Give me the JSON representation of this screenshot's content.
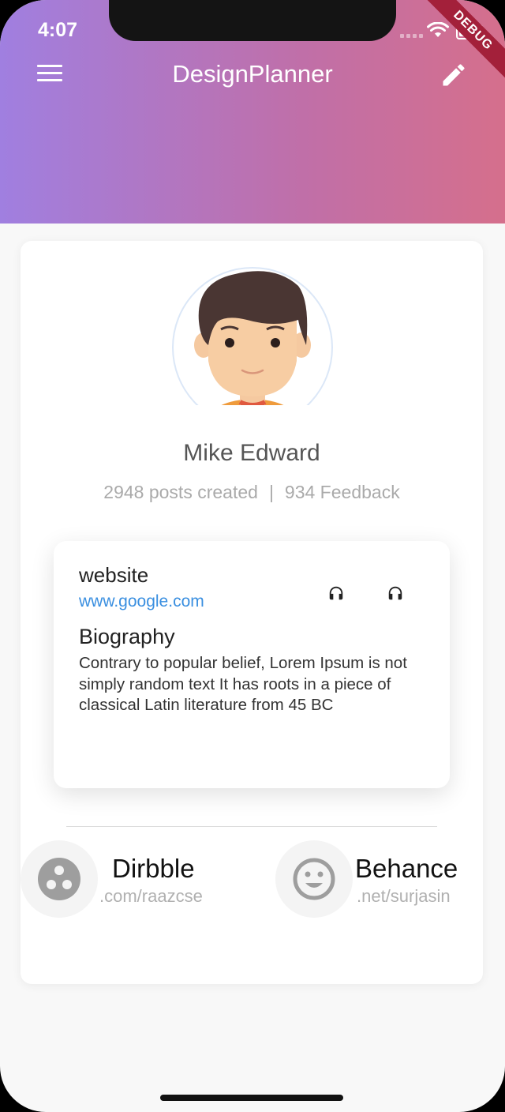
{
  "status_bar": {
    "time": "4:07",
    "debug_label": "DEBUG"
  },
  "app_bar": {
    "title": "DesignPlanner",
    "menu_icon": "menu-icon",
    "edit_icon": "pencil-icon"
  },
  "profile": {
    "name": "Mike Edward",
    "posts": "2948 posts created",
    "separator": "|",
    "feedback": "934 Feedback"
  },
  "info_card": {
    "website_label": "website",
    "website_url": "www.google.com",
    "biography_label": "Biography",
    "biography_text": "Contrary to popular belief, Lorem Ipsum is not simply random text It has roots in a piece of classical Latin literature from 45 BC",
    "icons": [
      "headphones-icon",
      "headphones-icon"
    ]
  },
  "social": [
    {
      "name": "Dirbble",
      "handle": ".com/raazcse",
      "icon": "dribbble-icon"
    },
    {
      "name": "Behance",
      "handle": ".net/surjasin",
      "icon": "smiley-icon"
    }
  ],
  "colors": {
    "gradient_start": "#a07fe0",
    "gradient_end": "#d56f8c",
    "link": "#3a8fe0"
  }
}
